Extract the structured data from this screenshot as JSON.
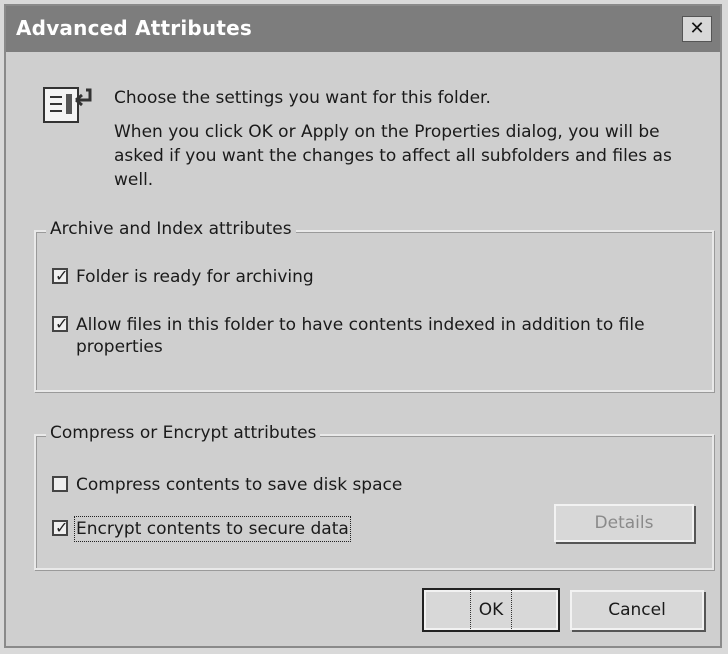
{
  "window": {
    "title": "Advanced Attributes",
    "close_glyph": "✕"
  },
  "intro": {
    "line1": "Choose the settings you want for this folder.",
    "line2": "When you click OK or Apply on the Properties dialog, you will be asked if you want the changes to affect all subfolders and files as well."
  },
  "archive_group": {
    "legend": "Archive and Index attributes",
    "items": [
      {
        "label": "Folder is ready for archiving",
        "checked": true
      },
      {
        "label": "Allow files in this folder to have contents indexed in addition to file properties",
        "checked": true
      }
    ]
  },
  "compress_group": {
    "legend": "Compress or Encrypt attributes",
    "items": [
      {
        "label": "Compress contents to save disk space",
        "checked": false
      },
      {
        "label": "Encrypt contents to secure data",
        "checked": true
      }
    ],
    "details_label": "Details"
  },
  "buttons": {
    "ok": "OK",
    "cancel": "Cancel"
  },
  "icons": {
    "folder": "folder-attributes-icon",
    "checkmark_glyph": "✓"
  }
}
